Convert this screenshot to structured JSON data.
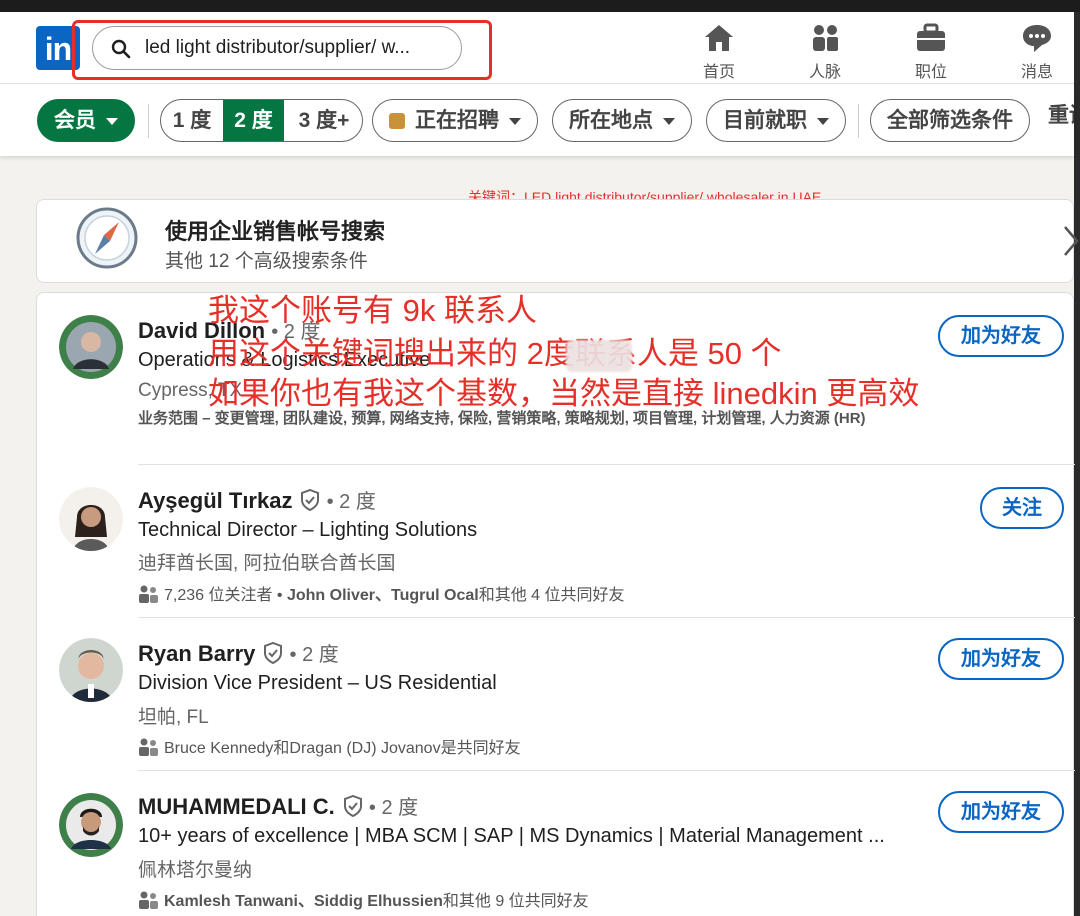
{
  "search": {
    "value": "led light distributor/supplier/ w..."
  },
  "nav": [
    {
      "label": "首页",
      "icon": "home-icon"
    },
    {
      "label": "人脉",
      "icon": "network-icon"
    },
    {
      "label": "职位",
      "icon": "briefcase-icon"
    },
    {
      "label": "消息",
      "icon": "messaging-icon"
    }
  ],
  "filters": {
    "member": "会员",
    "degree1": "1 度",
    "degree2": "2 度",
    "degree3": "3 度+",
    "hiring": "正在招聘",
    "location": "所在地点",
    "company": "目前就职",
    "all": "全部筛选条件",
    "reset_partial": "重设"
  },
  "keyword_note": "关键词：LED light distributor/supplier/ wholesaler in UAE",
  "sales_card": {
    "title": "使用企业销售帐号搜索",
    "subtitle": "其他 12 个高级搜索条件"
  },
  "annotation": {
    "line1": "我这个账号有 9k 联系人",
    "line2": "用这个关键词搜出来的    2度联系人是 50 个",
    "line3": "如果你也有我这个基数，当然是直接 linedkin 更高效"
  },
  "results": [
    {
      "name": "David Dillon",
      "degree": "• 2 度",
      "headline": "Operations & Logistics Executive",
      "location": "Cypress, TX",
      "summary": "业务范围 – 变更管理, 团队建设, 预算, 网络支持, 保险, 营销策略, 策略规划, 项目管理, 计划管理, 人力资源 (HR)",
      "action": "加为好友"
    },
    {
      "name": "Ayşegül Tırkaz",
      "degree": "• 2 度",
      "headline": "Technical Director – Lighting Solutions",
      "location": "迪拜酋长国, 阿拉伯联合酋长国",
      "mutual_prefix": "7,236 位关注者 • ",
      "mutual_names": "John Oliver、Tugrul Ocal",
      "mutual_suffix": "和其他 4 位共同好友",
      "action": "关注"
    },
    {
      "name": "Ryan Barry",
      "degree": "• 2 度",
      "headline": "Division Vice President – US Residential",
      "location": "坦帕, FL",
      "mutual_names": "Bruce Kennedy和Dragan (DJ) Jovanov是共同好友",
      "action": "加为好友"
    },
    {
      "name": "MUHAMMEDALI C.",
      "degree": "• 2 度",
      "headline": "10+ years of excellence | MBA SCM | SAP | MS Dynamics | Material Management ...",
      "location": "佩林塔尔曼纳",
      "mutual_names": "Kamlesh Tanwani、Siddig Elhussien",
      "mutual_suffix": "和其他 9 位共同好友",
      "action": "加为好友"
    }
  ],
  "colors": {
    "brand": "#0a66c2",
    "member_green": "#057642",
    "annotation_red": "#e5302a"
  }
}
